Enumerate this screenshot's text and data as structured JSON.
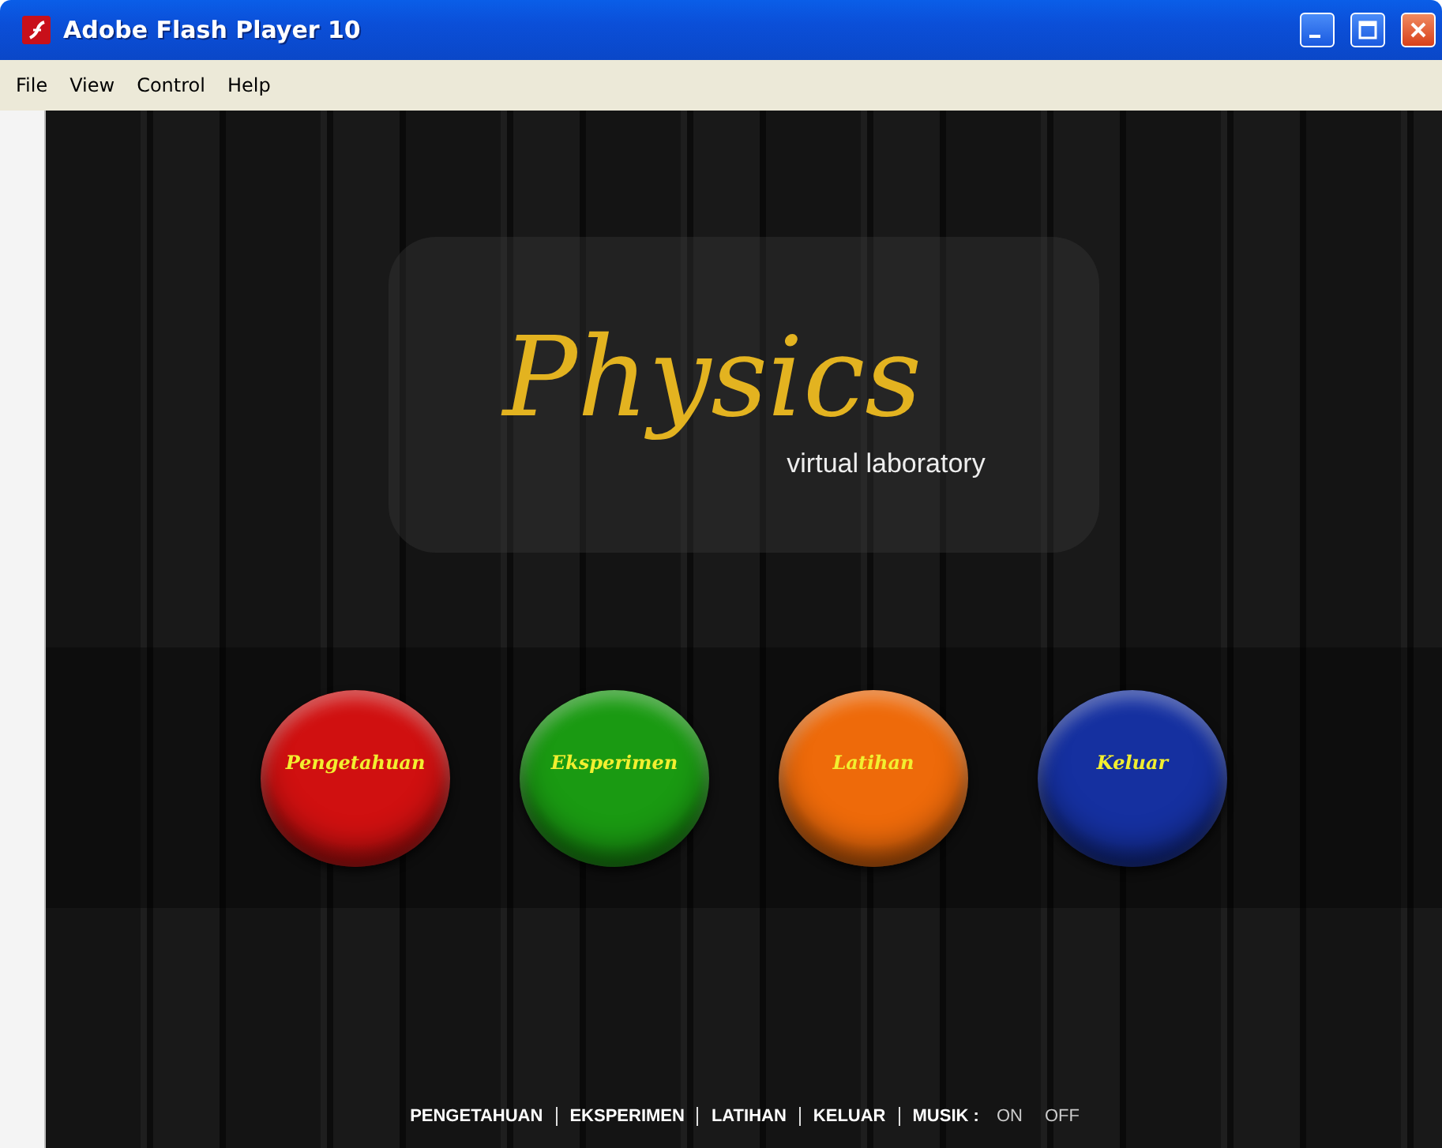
{
  "window": {
    "title": "Adobe Flash Player 10"
  },
  "menu": [
    "File",
    "View",
    "Control",
    "Help"
  ],
  "logo": {
    "title": "Physics",
    "subtitle": "virtual laboratory"
  },
  "buttons": [
    {
      "label": "Pengetahuan",
      "color": "#d01010"
    },
    {
      "label": "Eksperimen",
      "color": "#1a9a12"
    },
    {
      "label": "Latihan",
      "color": "#ee6a0a"
    },
    {
      "label": "Keluar",
      "color": "#1530a0"
    }
  ],
  "nav": [
    "PENGETAHUAN",
    "EKSPERIMEN",
    "LATIHAN",
    "KELUAR"
  ],
  "music": {
    "label": "MUSIK :",
    "options": [
      "ON",
      "OFF"
    ]
  }
}
